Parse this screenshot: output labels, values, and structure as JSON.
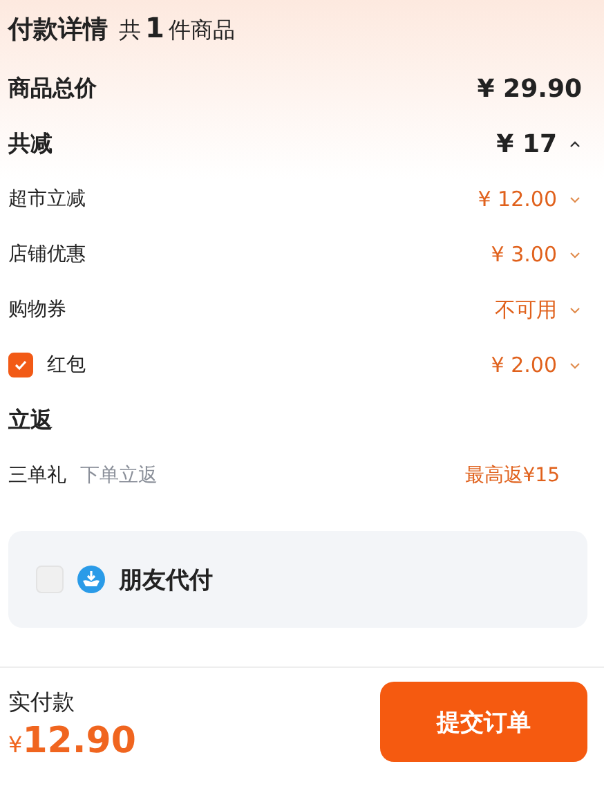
{
  "header": {
    "title": "付款详情",
    "count_prefix": "共",
    "count": "1",
    "count_suffix": "件商品"
  },
  "total": {
    "label": "商品总价",
    "value": "¥ 29.90"
  },
  "discount": {
    "label": "共减",
    "value": "¥ 17",
    "expanded": true,
    "items": [
      {
        "kind": "plain",
        "label": "超市立减",
        "value": "¥ 12.00",
        "expanded": false
      },
      {
        "kind": "plain",
        "label": "店铺优惠",
        "value": "¥ 3.00",
        "expanded": false
      },
      {
        "kind": "plain",
        "label": "购物券",
        "value": "不可用",
        "expanded": false
      },
      {
        "kind": "checkbox",
        "label": "红包",
        "value": "¥ 2.00",
        "checked": true,
        "expanded": false
      }
    ]
  },
  "rebate": {
    "title": "立返",
    "label": "三单礼",
    "hint": "下单立返",
    "value": "最高返¥15"
  },
  "friend_pay": {
    "label": "朋友代付",
    "checked": false
  },
  "footer": {
    "label": "实付款",
    "currency": "¥",
    "amount": "12.90",
    "button": "提交订单"
  }
}
